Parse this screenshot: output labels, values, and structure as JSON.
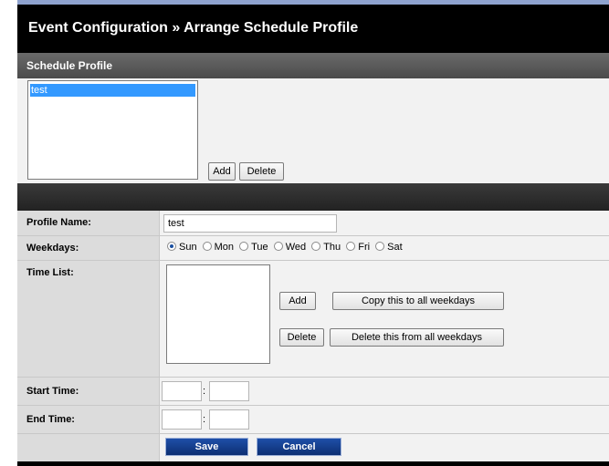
{
  "page_title": "Event Configuration » Arrange Schedule Profile",
  "schedule_profile": {
    "header": "Schedule Profile",
    "profiles": [
      "test"
    ],
    "add_label": "Add",
    "delete_label": "Delete"
  },
  "form": {
    "profile_name_label": "Profile Name:",
    "profile_name_value": "test",
    "weekdays_label": "Weekdays:",
    "weekdays": [
      {
        "label": "Sun",
        "selected": true
      },
      {
        "label": "Mon",
        "selected": false
      },
      {
        "label": "Tue",
        "selected": false
      },
      {
        "label": "Wed",
        "selected": false
      },
      {
        "label": "Thu",
        "selected": false
      },
      {
        "label": "Fri",
        "selected": false
      },
      {
        "label": "Sat",
        "selected": false
      }
    ],
    "time_list_label": "Time List:",
    "time_list_items": [],
    "add_label": "Add",
    "copy_label": "Copy this to all weekdays",
    "delete_label": "Delete",
    "delete_all_label": "Delete this from all weekdays",
    "start_time_label": "Start Time:",
    "end_time_label": "End Time:",
    "time_separator": ":",
    "start_hour": "",
    "start_minute": "",
    "end_hour": "",
    "end_minute": ""
  },
  "actions": {
    "save_label": "Save",
    "cancel_label": "Cancel"
  },
  "colors": {
    "selection": "#3399ff",
    "header": "#555555",
    "action_button": "#1a3f8a"
  }
}
